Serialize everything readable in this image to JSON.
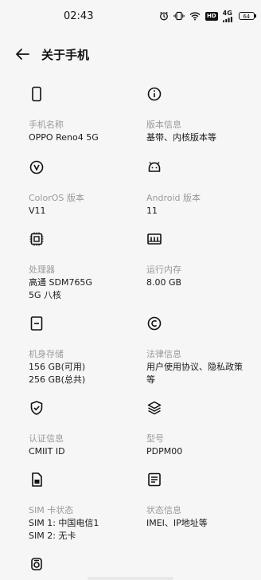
{
  "status_bar": {
    "time": "02:43",
    "hd": "HD",
    "net": "4G",
    "battery": "64"
  },
  "header": {
    "title": "关于手机"
  },
  "items": [
    {
      "label": "手机名称",
      "value": "OPPO Reno4 5G",
      "icon": "phone-icon"
    },
    {
      "label": "版本信息",
      "value": "基带、内核版本等",
      "icon": "info-icon"
    },
    {
      "label": "ColorOS 版本",
      "value": "V11",
      "icon": "coloros-icon"
    },
    {
      "label": "Android 版本",
      "value": "11",
      "icon": "android-icon"
    },
    {
      "label": "处理器",
      "value": "高通 SDM765G 5G 八核",
      "icon": "cpu-icon"
    },
    {
      "label": "运行内存",
      "value": "8.00 GB",
      "icon": "ram-icon"
    },
    {
      "label": "机身存储",
      "value": "156 GB(可用)\n256 GB(总共)",
      "icon": "storage-icon"
    },
    {
      "label": "法律信息",
      "value": "用户使用协议、隐私政策等",
      "icon": "copyright-icon"
    },
    {
      "label": "认证信息",
      "value": "CMIIT ID",
      "icon": "shield-icon"
    },
    {
      "label": "型号",
      "value": "PDPM00",
      "icon": "layers-icon"
    },
    {
      "label": "SIM 卡状态",
      "value": "SIM 1: 中国电信1\nSIM 2: 无卡",
      "icon": "sim-icon"
    },
    {
      "label": "状态信息",
      "value": "IMEI、IP地址等",
      "icon": "status-doc-icon"
    }
  ]
}
